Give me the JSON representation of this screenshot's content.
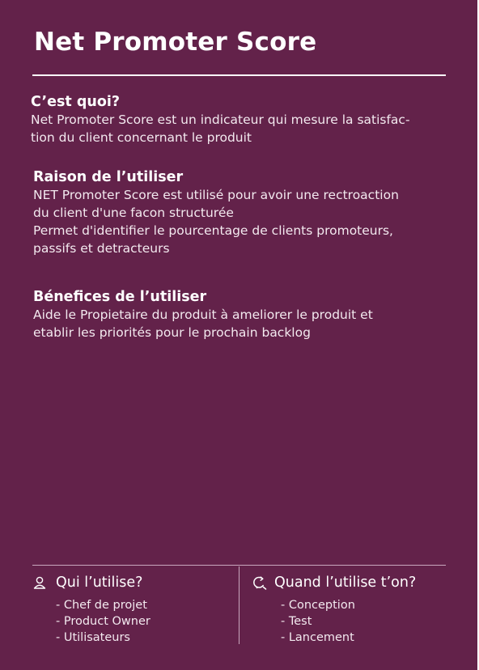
{
  "title": "Net Promoter Score",
  "sections": {
    "quoi": {
      "heading": "C’est quoi?",
      "lines": [
        "Net Promoter Score est un indicateur qui mesure la satisfac-",
        "tion du client concernant le produit"
      ]
    },
    "raison": {
      "heading": "Raison de l’utiliser",
      "lines": [
        "NET Promoter Score est utilisé pour avoir une rectroaction",
        "du client d'une facon structurée",
        "Permet d'identifier le pourcentage de clients promoteurs,",
        "passifs et detracteurs"
      ]
    },
    "benefices": {
      "heading": "Bénefices de l’utiliser",
      "lines": [
        "Aide le Propietaire du produit à ameliorer le produit et",
        "etablir les priorités pour le prochain backlog"
      ]
    }
  },
  "footer": {
    "who": {
      "icon": "person-icon",
      "heading": "Qui l’utilise?",
      "items": [
        "- Chef de projet",
        "- Product Owner",
        "- Utilisateurs"
      ]
    },
    "when": {
      "icon": "cycle-icon",
      "heading": "Quand l’utilise t’on?",
      "items": [
        "- Conception",
        "- Test",
        "- Lancement"
      ]
    }
  },
  "colors": {
    "background": "#63224a",
    "text": "#ffffff"
  }
}
